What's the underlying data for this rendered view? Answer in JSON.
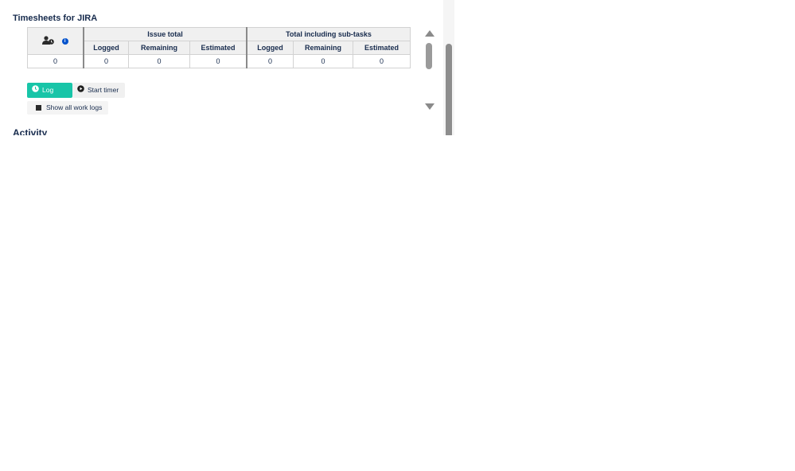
{
  "panel": {
    "title": "Timesheets for JIRA",
    "next_section_title": "Activity"
  },
  "table": {
    "user_icon": "user-clock-icon",
    "info_icon": "info-icon",
    "group_headers": [
      "Issue total",
      "Total including sub-tasks"
    ],
    "sub_headers": [
      "Logged",
      "Remaining",
      "Estimated",
      "Logged",
      "Remaining",
      "Estimated"
    ],
    "row": [
      "0",
      "0",
      "0",
      "0",
      "0",
      "0",
      "0"
    ]
  },
  "actions": {
    "log_time": "Log time",
    "start_timer": "Start timer",
    "show_all": "Show all work logs"
  },
  "colors": {
    "log_time_bg": "#18c5a8",
    "info_icon": "#0052cc"
  }
}
